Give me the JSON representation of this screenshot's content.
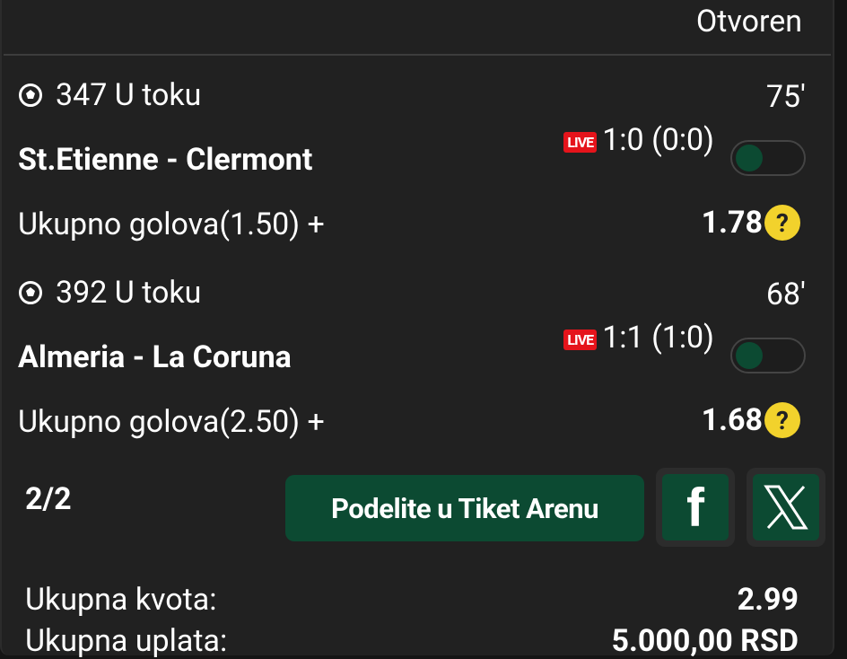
{
  "ticket": {
    "status": "Otvoren",
    "matches": [
      {
        "event": "347 U toku",
        "minute": "75'",
        "teams": "St.Etienne - Clermont",
        "live_label": "LIVE",
        "score": "1:0 (0:0)",
        "market": "Ukupno golova(1.50) +",
        "odd": "1.78",
        "help": "?"
      },
      {
        "event": "392 U toku",
        "minute": "68'",
        "teams": "Almeria - La Coruna",
        "live_label": "LIVE",
        "score": "1:1 (1:0)",
        "market": "Ukupno golova(2.50) +",
        "odd": "1.68",
        "help": "?"
      }
    ],
    "count": "2/2",
    "share_label": "Podelite u Tiket Arenu",
    "facebook_label": "f",
    "total_odds_label": "Ukupna kvota:",
    "total_odds_value": "2.99",
    "total_stake_label": "Ukupna uplata:",
    "total_stake_value": "5.000,00 RSD"
  },
  "colors": {
    "background": "#212121",
    "accent_green": "#0c4a32",
    "live_red": "#e5141b",
    "help_yellow": "#f2d22c"
  },
  "icons": [
    "football-icon",
    "live-icon",
    "question-icon",
    "facebook-icon",
    "x-icon"
  ]
}
